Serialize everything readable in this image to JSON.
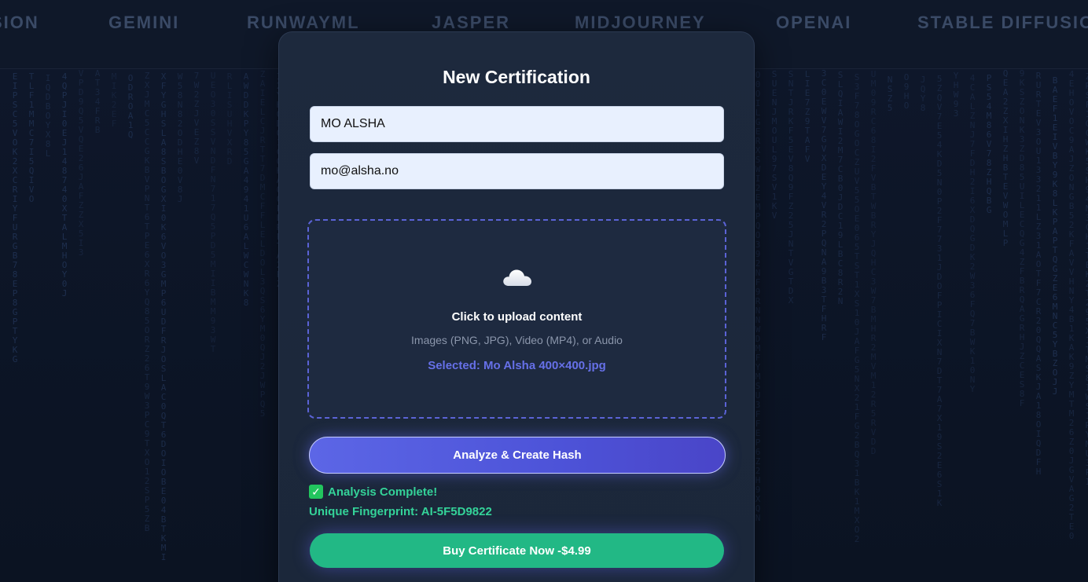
{
  "brands": [
    "SION",
    "GEMINI",
    "RUNWAYML",
    "JASPER",
    "MIDJOURNEY",
    "OPENAI",
    "STABLE DIFFUSIO"
  ],
  "card": {
    "title": "New Certification",
    "name_value": "MO ALSHA",
    "email_value": "mo@alsha.no",
    "upload": {
      "icon": "cloud-icon",
      "title": "Click to upload content",
      "hint": "Images (PNG, JPG), Video (MP4), or Audio",
      "selected": "Selected: Mo Alsha 400×400.jpg"
    },
    "analyze_label": "Analyze & Create Hash",
    "status_text": "Analysis Complete!",
    "fingerprint_text": "Unique Fingerprint: AI-5F5D9822",
    "buy_label": "Buy Certificate Now -$4.99"
  },
  "colors": {
    "accent": "#5c66e6",
    "success": "#34d399",
    "buy": "#22b885",
    "background": "#0c1425"
  }
}
